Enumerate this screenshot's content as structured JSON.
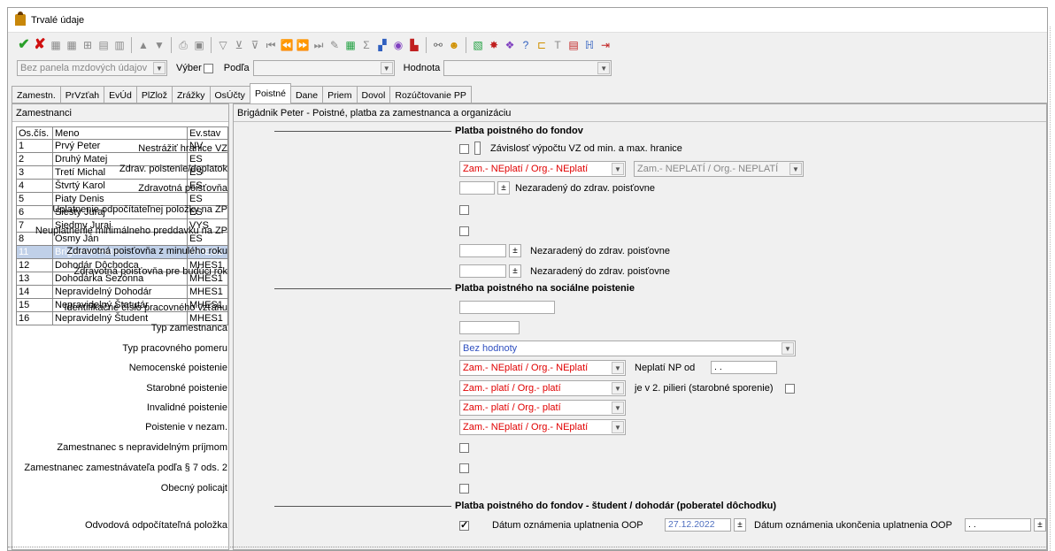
{
  "window": {
    "title": "Trvalé údaje"
  },
  "toolbar": {
    "icons": [
      "confirm-icon",
      "cancel-icon",
      "grid-icon",
      "grid2-icon",
      "add-row-icon",
      "edit-row-icon",
      "delete-row-icon",
      "up-arrow-icon",
      "down-arrow-icon",
      "print-icon",
      "preview-icon",
      "filter-icon",
      "filter-clear-icon",
      "filter-off-icon",
      "first-icon",
      "prev-page-icon",
      "next-page-icon",
      "last-icon",
      "bookmark-icon",
      "table-icon",
      "sum-icon",
      "chart-icon",
      "palette-icon",
      "export-icon",
      "binoculars-icon",
      "search-person-icon",
      "excel-icon",
      "star-icon",
      "puzzle-icon",
      "help-icon",
      "tree-icon",
      "split-icon",
      "calendar-icon",
      "book-icon",
      "exit-icon"
    ]
  },
  "filter": {
    "panel_combo": "Bez panela mzdových údajov",
    "vyber_label": "Výber",
    "podla_label": "Podľa",
    "podla_value": "",
    "hodnota_label": "Hodnota",
    "hodnota_value": ""
  },
  "tabs": [
    "Zamestn.",
    "PrVzťah",
    "EvÚd",
    "PlZlož",
    "Zrážky",
    "OsÚčty",
    "Poistné",
    "Dane",
    "Priem",
    "Dovol",
    "Rozúčtovanie PP"
  ],
  "active_tab": "Poistné",
  "left_panel": {
    "title": "Zamestnanci",
    "columns": [
      "Os.čís.",
      "Meno",
      "Ev.stav"
    ],
    "rows": [
      [
        "1",
        "Prvý Peter",
        "NV"
      ],
      [
        "2",
        "Druhý Matej",
        "ES"
      ],
      [
        "3",
        "Tretí Michal",
        "ES"
      ],
      [
        "4",
        "Štvrtý Karol",
        "ES"
      ],
      [
        "5",
        "Piaty Denis",
        "ES"
      ],
      [
        "6",
        "Siesty Juraj",
        "ES"
      ],
      [
        "7",
        "Siedmy Juraj",
        "VYS"
      ],
      [
        "8",
        "Osmy Ján",
        "ES"
      ],
      [
        "11",
        "Brigádnik Peter",
        "MHES1"
      ],
      [
        "12",
        "Dohodár Dôchodca",
        "MHES1"
      ],
      [
        "13",
        "Dohodárka Sezónna",
        "MHES1"
      ],
      [
        "14",
        "Nepravidelný Dohodár",
        "MHES1"
      ],
      [
        "15",
        "Nepravidelný Štatutár",
        "MHES1"
      ],
      [
        "16",
        "Nepravidelný Študent",
        "MHES1"
      ]
    ],
    "selected_index": 8
  },
  "right_panel": {
    "title": "Brigádnik Peter - Poistné, platba za zamestnanca a organizáciu"
  },
  "form": {
    "sec1": "Platba poistného do fondov",
    "nestrazit": "Nestrážiť hranice VZ",
    "zavislost": "Závislosť výpočtu VZ od min. a max. hranice",
    "zdrav_doplatok": "Zdrav. poistenie/doplatok",
    "zdrav_doplatok_val": "Zam.- NEplatí / Org.- NEplatí",
    "zdrav_doplatok_val2": "Zam.- NEPLATÍ  / Org.- NEPLATÍ",
    "zdrav_poistovna": "Zdravotná poisťovňa",
    "nezaradeny": "Nezaradený do zdrav. poisťovne",
    "uplatnenie_odp": "Uplatnenie odpočítateľnej položky na ZP",
    "neuplatnenie_min": "Neuplatnenie minimálneho preddavku na ZP",
    "zp_minuly": "Zdravotná poisťovňa z minulého roku",
    "zp_buduci": "Zdravotná poisťovňa pre budúci rok",
    "sec2": "Platba poistného na sociálne poistenie",
    "ident": "Identifikačné číslo pracovného vzťahu",
    "typ_zam": "Typ zamestnanca",
    "typ_pomeru": "Typ pracovného pomeru",
    "typ_pomeru_val": "Bez hodnoty",
    "nemocenske": "Nemocenské poistenie",
    "neplati_np": "Neplatí NP od",
    "neplati_np_val": "  .  .",
    "starobne": "Starobné poistenie",
    "plati_val": "Zam.- platí   /  Org.- platí",
    "neplati_val": "Zam.- NEplatí / Org.- NEplatí",
    "pilier": "je v 2. pilieri (starobné sporenie)",
    "invalidne": "Invalidné poistenie",
    "nezam": "Poistenie v nezam.",
    "nepravidelny": "Zamestnanec s nepravidelným príjmom",
    "par7": "Zamestnanec zamestnávateľa podľa § 7 ods. 2",
    "policajt": "Obecný policajt",
    "sec3": "Platba poistného do fondov - študent / dohodár (poberatel dôchodku)",
    "odvodova": "Odvodová odpočítateľná položka",
    "datum_ozn": "Dátum oznámenia uplatnenia OOP",
    "datum_ozn_val": "27.12.2022",
    "datum_ukon": "Dátum oznámenia ukončenia uplatnenia OOP",
    "datum_ukon_val": "  .  ."
  }
}
